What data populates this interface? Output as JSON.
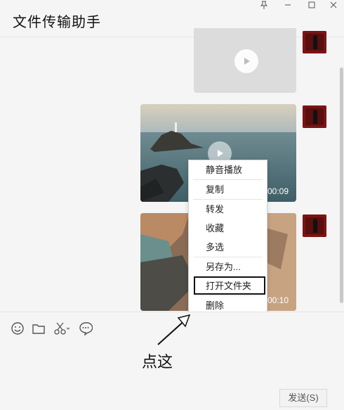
{
  "window": {
    "title": "文件传输助手",
    "controls": {
      "pin": "pin-icon",
      "minimize": "minimize-icon",
      "maximize": "maximize-icon",
      "close": "close-icon"
    }
  },
  "messages": [
    {
      "type": "video",
      "thumbnail": "gray-placeholder",
      "duration": ""
    },
    {
      "type": "video",
      "thumbnail": "coastal-rocks",
      "duration": "00:09"
    },
    {
      "type": "video",
      "thumbnail": "cliffs",
      "duration": "00:10"
    }
  ],
  "context_menu": {
    "items": [
      "静音播放",
      "复制",
      "转发",
      "收藏",
      "多选",
      "另存为...",
      "打开文件夹",
      "删除"
    ],
    "highlighted": "打开文件夹"
  },
  "toolbar": {
    "icons": [
      "emoji-icon",
      "folder-icon",
      "scissors-icon",
      "chat-bubble-icon"
    ]
  },
  "send_button": {
    "label": "发送(S)"
  },
  "annotation": {
    "text": "点这"
  },
  "colors": {
    "background": "#f5f5f5",
    "menu_highlight_border": "#111111",
    "avatar": "#6e1515"
  }
}
